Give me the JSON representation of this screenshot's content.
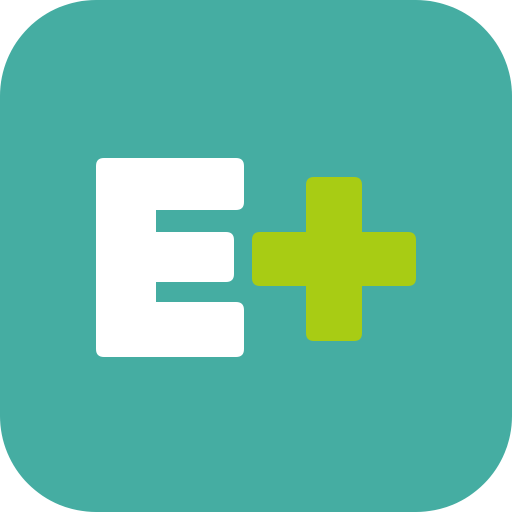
{
  "app_icon": {
    "logo_text": "E+",
    "icon_name": "e-plus-logo-icon",
    "colors": {
      "background": "#45ADA2",
      "letter": "#FFFFFF",
      "plus": "#A8CC14"
    }
  }
}
